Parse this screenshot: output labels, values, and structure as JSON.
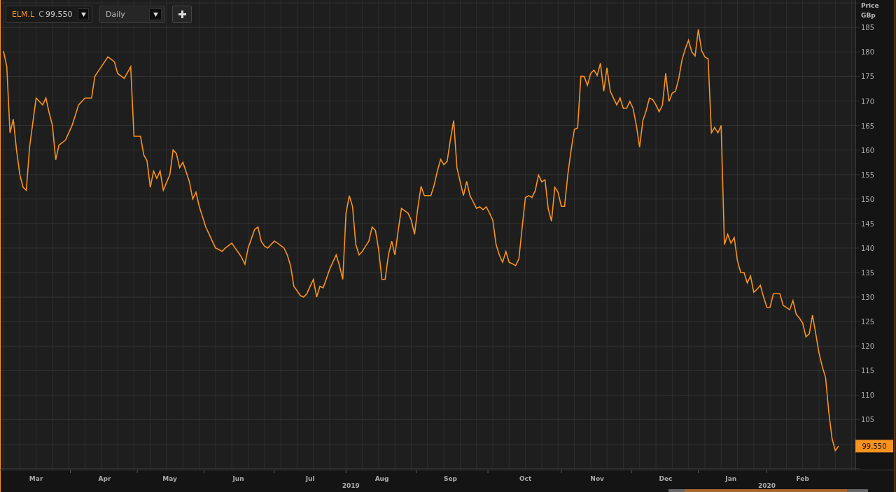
{
  "toolbar": {
    "close_label": "C",
    "close": "99.550",
    "interval": "Daily"
  },
  "chart": {
    "axis_title": "Price",
    "unit": "GBp",
    "last_price": "99.550",
    "chart_data": {
      "type": "line",
      "grid": true,
      "ylim": [
        94.8,
        190.6
      ],
      "yticks": [
        105,
        110,
        115,
        120,
        125,
        130,
        135,
        140,
        145,
        150,
        155,
        160,
        165,
        170,
        175,
        180,
        185
      ],
      "categories": [
        null,
        null,
        null,
        null,
        null,
        null,
        null,
        null,
        null,
        null,
        "Mar",
        null,
        null,
        null,
        null,
        null,
        null,
        null,
        null,
        null,
        null,
        null,
        null,
        null,
        null,
        null,
        null,
        null,
        null,
        null,
        null,
        "Apr",
        null,
        null,
        null,
        null,
        null,
        null,
        null,
        null,
        null,
        null,
        null,
        null,
        null,
        null,
        null,
        null,
        null,
        null,
        null,
        "May",
        null,
        null,
        null,
        null,
        null,
        null,
        null,
        null,
        null,
        null,
        null,
        null,
        null,
        null,
        null,
        null,
        null,
        null,
        null,
        null,
        "Jun",
        null,
        null,
        null,
        null,
        null,
        null,
        null,
        null,
        null,
        null,
        null,
        null,
        null,
        null,
        null,
        null,
        null,
        null,
        null,
        null,
        null,
        "Jul",
        null,
        null,
        null,
        null,
        null,
        null,
        null,
        null,
        null,
        null,
        null,
        null,
        null,
        null,
        null,
        null,
        null,
        null,
        null,
        null,
        null,
        "Aug",
        null,
        null,
        null,
        null,
        null,
        null,
        null,
        null,
        null,
        null,
        null,
        null,
        null,
        null,
        null,
        null,
        null,
        null,
        null,
        null,
        "Sep",
        null,
        null,
        null,
        null,
        null,
        null,
        null,
        null,
        null,
        null,
        null,
        null,
        null,
        null,
        null,
        null,
        null,
        null,
        null,
        null,
        null,
        null,
        "Oct",
        null,
        null,
        null,
        null,
        null,
        null,
        null,
        null,
        null,
        null,
        null,
        null,
        null,
        null,
        null,
        null,
        null,
        null,
        null,
        null,
        null,
        "Nov",
        null,
        null,
        null,
        null,
        null,
        null,
        null,
        null,
        null,
        null,
        null,
        null,
        null,
        null,
        null,
        null,
        null,
        null,
        null,
        null,
        "Dec",
        null,
        null,
        null,
        null,
        null,
        null,
        null,
        null,
        null,
        null,
        null,
        null,
        null,
        null,
        null,
        null,
        null,
        null,
        null,
        "Jan",
        null,
        null,
        null,
        null,
        null,
        null,
        null,
        null,
        null,
        null,
        null,
        null,
        null,
        null,
        null,
        null,
        null,
        null,
        null,
        null,
        null,
        "Feb",
        null,
        null,
        null,
        null,
        null,
        null,
        null,
        null,
        null,
        null,
        null
      ],
      "series": [
        {
          "name": "ELM.L",
          "color": "#f7931e",
          "values": [
            180.2,
            177,
            163.5,
            166.3,
            160,
            155,
            152.4,
            151.8,
            160.6,
            165.6,
            170.6,
            169.9,
            169.2,
            170.6,
            167.6,
            165,
            158,
            161,
            161.5,
            162,
            163.5,
            165,
            167,
            169.2,
            169.9,
            170.6,
            170.6,
            170.6,
            175,
            176,
            177,
            178,
            179,
            178.5,
            178,
            175.6,
            175.1,
            174.6,
            175.8,
            177,
            162.8,
            162.8,
            162.8,
            159,
            157.8,
            152.4,
            155.7,
            154.2,
            155.7,
            151.8,
            153.4,
            155,
            160,
            159.3,
            156.4,
            157.5,
            155.5,
            153.5,
            150,
            151.4,
            148.5,
            146.4,
            144.3,
            142.9,
            141.4,
            140,
            139.7,
            139.3,
            140,
            140.5,
            141,
            140,
            139.1,
            138.1,
            136.7,
            140,
            141.9,
            143.8,
            144.3,
            141.4,
            140.4,
            140,
            140.7,
            141.4,
            141,
            140.5,
            140,
            138.6,
            136.4,
            132.2,
            131.3,
            130.3,
            130,
            130.7,
            132.2,
            133.6,
            130,
            132.2,
            131.9,
            133.8,
            135.7,
            137.2,
            138.6,
            136.4,
            133.6,
            147.1,
            150.7,
            148.5,
            140.7,
            138.6,
            139.3,
            140.4,
            141.4,
            144.3,
            143.6,
            139.7,
            133.6,
            133.6,
            138.6,
            141.4,
            138.6,
            143.6,
            148.1,
            147.6,
            147.1,
            145.7,
            142.8,
            148.1,
            152.6,
            150.7,
            150.7,
            150.7,
            152.8,
            155.7,
            158.1,
            157,
            157.7,
            162.1,
            166,
            156.4,
            153.5,
            150.7,
            153.6,
            150.7,
            149.4,
            148.1,
            148.4,
            147.8,
            148.4,
            147.1,
            145.7,
            140.7,
            138.6,
            137.1,
            139.3,
            137.1,
            136.8,
            136.4,
            137.8,
            144.3,
            150.3,
            150.7,
            150.3,
            151.7,
            154.9,
            153.5,
            153.9,
            148,
            145.5,
            152.4,
            151.4,
            148.5,
            148.5,
            155,
            160,
            164.2,
            164.5,
            175,
            175,
            173.2,
            175.6,
            176.3,
            175.2,
            177.7,
            172,
            176.8,
            172,
            170.6,
            169.2,
            170.6,
            168.5,
            168.5,
            169.9,
            168.5,
            165,
            160.6,
            166,
            168,
            170.6,
            170.3,
            169.2,
            167.8,
            169.2,
            175.6,
            169.9,
            171.6,
            172,
            174.6,
            178.4,
            180.6,
            182.4,
            180,
            179.2,
            184.6,
            180.3,
            179,
            178.6,
            163.5,
            164.6,
            163.5,
            165,
            140.7,
            142.8,
            141,
            142.1,
            137.4,
            135,
            135,
            132.9,
            134.3,
            131,
            131.6,
            132.4,
            130,
            127.9,
            127.9,
            130.7,
            130.7,
            130.7,
            128.3,
            127.9,
            127.4,
            129.3,
            126.5,
            125.7,
            124.7,
            121.9,
            122.5,
            126.3,
            122.5,
            118.6,
            115.8,
            113.6,
            106.5,
            101.1,
            98.7,
            99.6
          ]
        }
      ],
      "annotations": [
        {
          "text": "2019"
        },
        {
          "text": "2020"
        }
      ]
    }
  }
}
